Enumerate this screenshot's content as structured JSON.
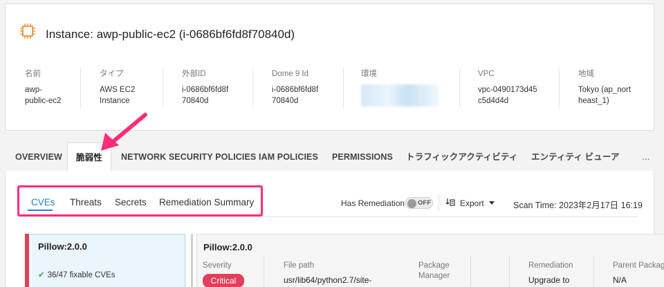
{
  "instance": {
    "title": "Instance: awp-public-ec2 (i-0686bf6fd8f70840d)",
    "fields": [
      {
        "label": "名前",
        "value": "awp-\npublic-ec2"
      },
      {
        "label": "タイプ",
        "value": "AWS EC2\nInstance"
      },
      {
        "label": "外部ID",
        "value": "i-0686bf6fd8f\n70840d"
      },
      {
        "label": "Dome 9 Id",
        "value": "i-0686bf6fd8f\n70840d"
      },
      {
        "label": "環境",
        "value": ""
      },
      {
        "label": "VPC",
        "value": "vpc-0490173d45\nc5d4d4d"
      },
      {
        "label": "地域",
        "value": "Tokyo (ap_nort\nheast_1)"
      }
    ]
  },
  "tabs": [
    "OVERVIEW",
    "脆弱性",
    "NETWORK SECURITY POLICIES",
    "IAM POLICIES",
    "PERMISSIONS",
    "トラフィックアクティビティ",
    "エンティティ ビューア",
    "..."
  ],
  "subtabs": [
    "CVEs",
    "Threats",
    "Secrets",
    "Remediation Summary"
  ],
  "toolbar": {
    "has_remediation": "Has Remediation",
    "toggle_state": "OFF",
    "export": "Export",
    "scan_time": "Scan Time: 2023年2月17日 16:19"
  },
  "package": {
    "name": "Pillow:2.0.0",
    "fixable": "36/47 fixable CVEs"
  },
  "detail": {
    "name": "Pillow:2.0.0",
    "severity_label": "Severity",
    "severity": "Critical",
    "filepath_label": "File path",
    "filepath": "usr/lib64/python2.7/site-",
    "pkgmgr_label": "Package\nManager",
    "remediation_label": "Remediation",
    "remediation": "Upgrade to",
    "parent_label": "Parent Package",
    "parent": "N/A"
  },
  "colors": {
    "accent": "#2a7bd1",
    "highlight": "#ff2d7a",
    "critical": "#e0405a",
    "chip": "#e8872b"
  }
}
